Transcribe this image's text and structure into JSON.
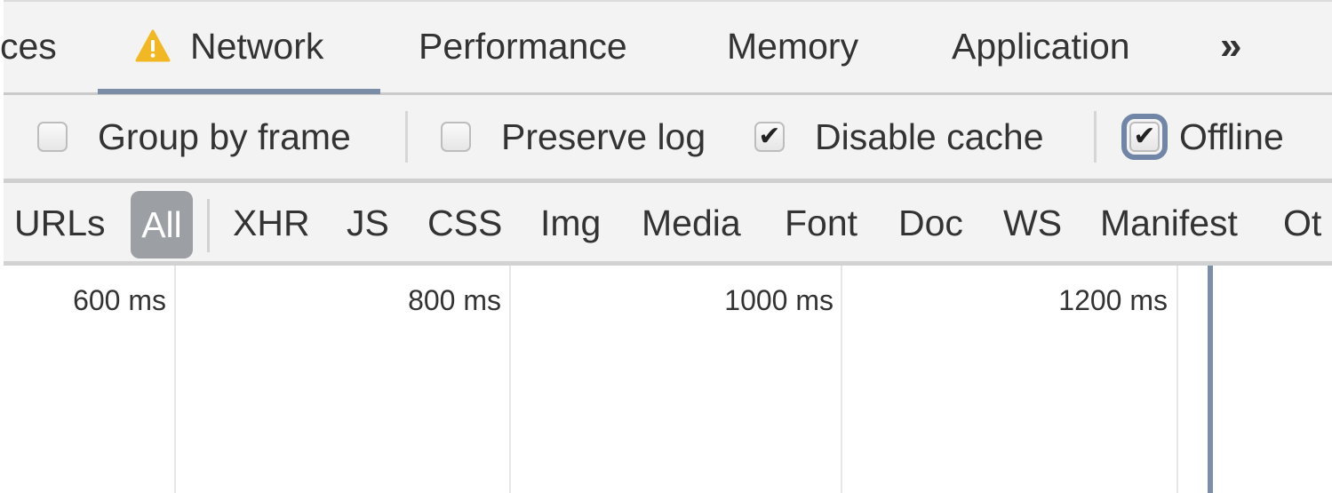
{
  "tabs": [
    {
      "id": "sources",
      "label": "ces"
    },
    {
      "id": "network",
      "label": "Network",
      "active": true,
      "icon": "warning-icon"
    },
    {
      "id": "performance",
      "label": "Performance"
    },
    {
      "id": "memory",
      "label": "Memory"
    },
    {
      "id": "application",
      "label": "Application"
    },
    {
      "id": "more",
      "label": "»",
      "icon": "more-tabs-icon"
    }
  ],
  "options": [
    {
      "id": "group_by_frame",
      "label": "Group by frame",
      "checked": false
    },
    {
      "id": "preserve_log",
      "label": "Preserve log",
      "checked": false
    },
    {
      "id": "disable_cache",
      "label": "Disable cache",
      "checked": true
    },
    {
      "id": "offline",
      "label": "Offline",
      "checked": true,
      "focused": true
    }
  ],
  "filters": {
    "prefix": "URLs",
    "all_label": "All",
    "types": [
      "XHR",
      "JS",
      "CSS",
      "Img",
      "Media",
      "Font",
      "Doc",
      "WS",
      "Manifest",
      "Ot"
    ]
  },
  "timeline": {
    "ticks": [
      "600 ms",
      "800 ms",
      "1000 ms",
      "1200 ms"
    ]
  },
  "colors": {
    "warning": "#f2b824",
    "active_tab_underline": "#7a8ca6",
    "all_filter_bg": "#9ca0a4",
    "timeline_marker": "#7d8ea8"
  }
}
